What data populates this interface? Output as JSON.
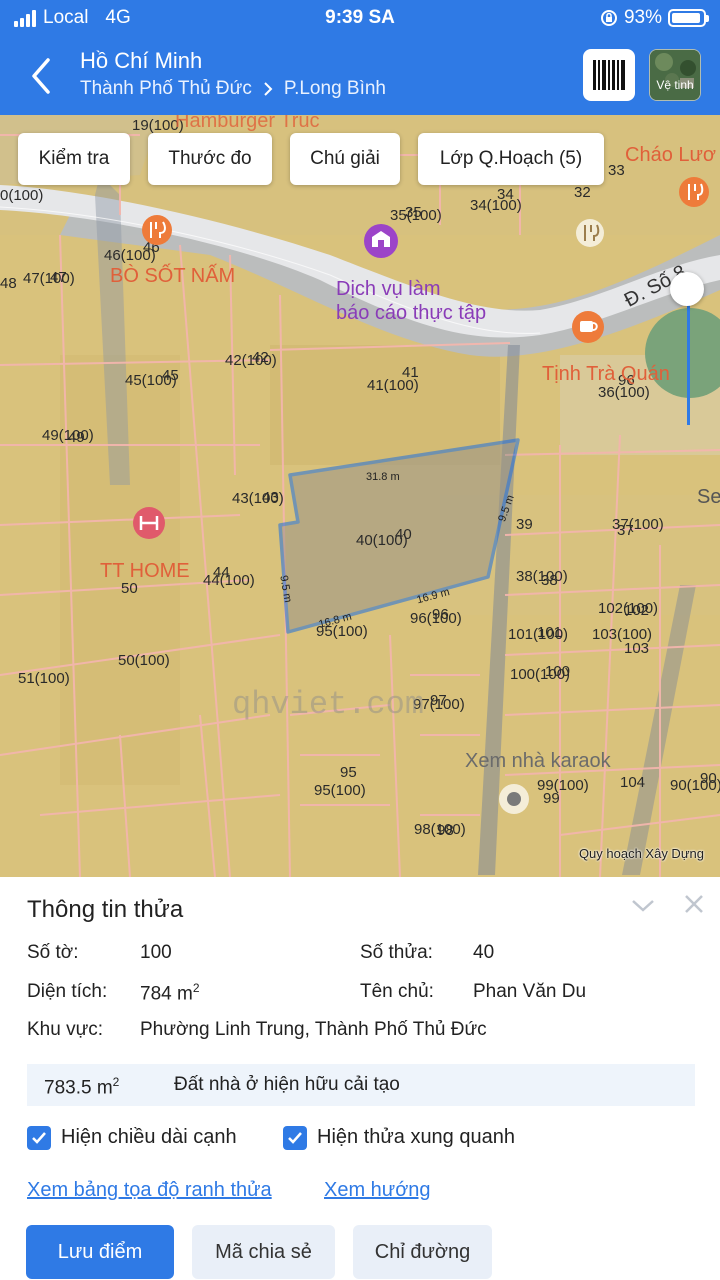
{
  "status_bar": {
    "carrier": "Local",
    "network": "4G",
    "time": "9:39 SA",
    "battery": "93%",
    "battery_level": 0.93
  },
  "header": {
    "title": "Hồ Chí Minh",
    "breadcrumb": [
      "Thành Phố Thủ Đức",
      "P.Long Bình"
    ],
    "satellite_label": "Vệ tinh"
  },
  "map": {
    "toolbar": [
      "Kiểm tra",
      "Thước đo",
      "Chú giải",
      "Lớp Q.Hoạch (5)"
    ],
    "attribution": "Quy hoạch Xây Dựng",
    "watermark": "qhviet.com",
    "pois": [
      "Hamburger Trúc",
      "BÒ SỐT NẤM",
      "Dịch vụ làm",
      "báo cáo thực tập",
      "Cháo Lươ",
      "Tịnh Trà Quán",
      "TT HOME",
      "Xem nhà karaok",
      "Đ. Số 8",
      "Se"
    ],
    "edges": [
      "31.8 m",
      "9.5 m",
      "9.5 m",
      "16.9 m",
      "16.8 m"
    ],
    "parcel_labels": [
      "19(100)",
      "0(100)",
      "35",
      "35(100)",
      "34",
      "34(100)",
      "32",
      "33",
      "46",
      "46(100)",
      "47",
      "47(100)",
      "48",
      "42",
      "42(100)",
      "45",
      "45(100)",
      "41",
      "41(100)",
      "96",
      "36(100)",
      "49",
      "49(100)",
      "43",
      "43(100)",
      "40",
      "40(100)",
      "39",
      "37",
      "37(100)",
      "38",
      "38(100)",
      "44",
      "44(100)",
      "50",
      "50(100)",
      "102",
      "102(100)",
      "103",
      "103(100)",
      "101",
      "101(100)",
      "100",
      "100(100)",
      "96",
      "96(100)",
      "95(100)",
      "51(100)",
      "97",
      "97(100)",
      "99",
      "99(100)",
      "104",
      "90",
      "90(100)",
      "95",
      "95(100)",
      "98",
      "98(100)"
    ]
  },
  "panel": {
    "title": "Thông tin thửa",
    "so_to_label": "Số tờ:",
    "so_to": "100",
    "so_thua_label": "Số thửa:",
    "so_thua": "40",
    "dien_tich_label": "Diện tích:",
    "dien_tich": "784 m",
    "unit_sup": "2",
    "ten_chu_label": "Tên chủ:",
    "ten_chu": "Phan Văn Du",
    "khu_vuc_label": "Khu vực:",
    "khu_vuc": "Phường Linh Trung, Thành Phố Thủ Đức",
    "land_area": "783.5 m",
    "land_type": "Đất nhà ở hiện hữu cải tạo",
    "cb1": "Hiện chiều dài cạnh",
    "cb2": "Hiện thửa xung quanh",
    "link1": "Xem bảng tọa độ ranh thửa",
    "link2": "Xem hướng",
    "btn_save": "Lưu điểm",
    "btn_share": "Mã chia sẻ",
    "btn_directions": "Chỉ đường"
  },
  "colors": {
    "primary": "#2f7ae5",
    "map_land": "#d7c07a",
    "parcel_line": "#f5b7b0",
    "highlight": "#1e6fe0"
  }
}
